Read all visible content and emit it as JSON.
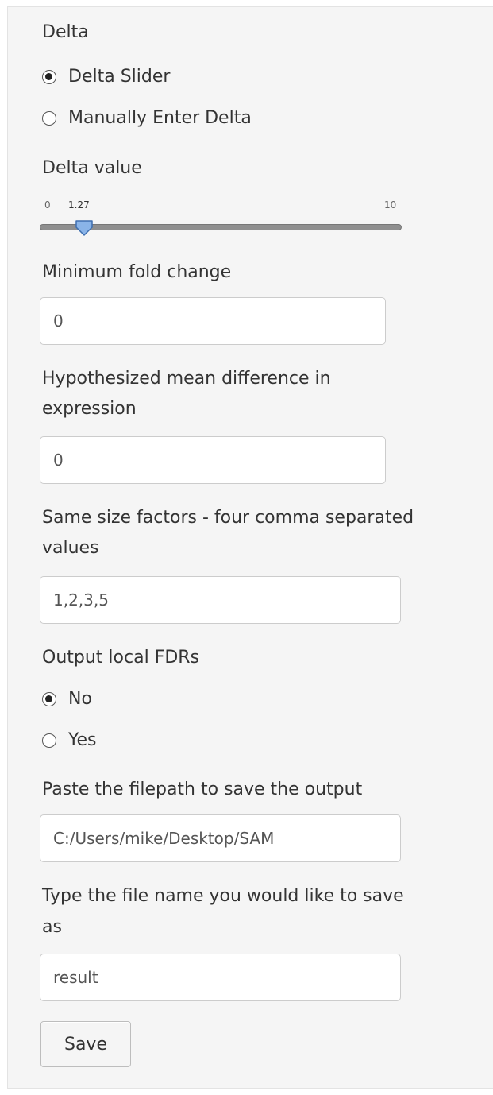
{
  "delta": {
    "label": "Delta",
    "options": [
      {
        "label": "Delta Slider",
        "selected": true
      },
      {
        "label": "Manually Enter Delta",
        "selected": false
      }
    ]
  },
  "delta_value": {
    "label": "Delta value",
    "min": "0",
    "max": "10",
    "value": "1.27",
    "value_number": 1.27
  },
  "min_fold_change": {
    "label": "Minimum fold change",
    "value": "0"
  },
  "hyp_mean_diff": {
    "label_line1": "Hypothesized mean difference in",
    "label_line2": "expression",
    "value": "0"
  },
  "size_factors": {
    "label_line1": "Same size factors - four comma separated",
    "label_line2": "values",
    "value": "1,2,3,5"
  },
  "local_fdrs": {
    "label": "Output local FDRs",
    "options": [
      {
        "label": "No",
        "selected": true
      },
      {
        "label": "Yes",
        "selected": false
      }
    ]
  },
  "filepath": {
    "label": "Paste the filepath to save the output",
    "value": "C:/Users/mike/Desktop/SAM"
  },
  "filename": {
    "label_line1": "Type the file name you would like to save",
    "label_line2": "as",
    "value": "result"
  },
  "save_button": {
    "label": "Save"
  },
  "colors": {
    "panel_bg": "#f5f5f5",
    "handle_fill": "#8ab4e8",
    "handle_stroke": "#3f6fb0"
  }
}
